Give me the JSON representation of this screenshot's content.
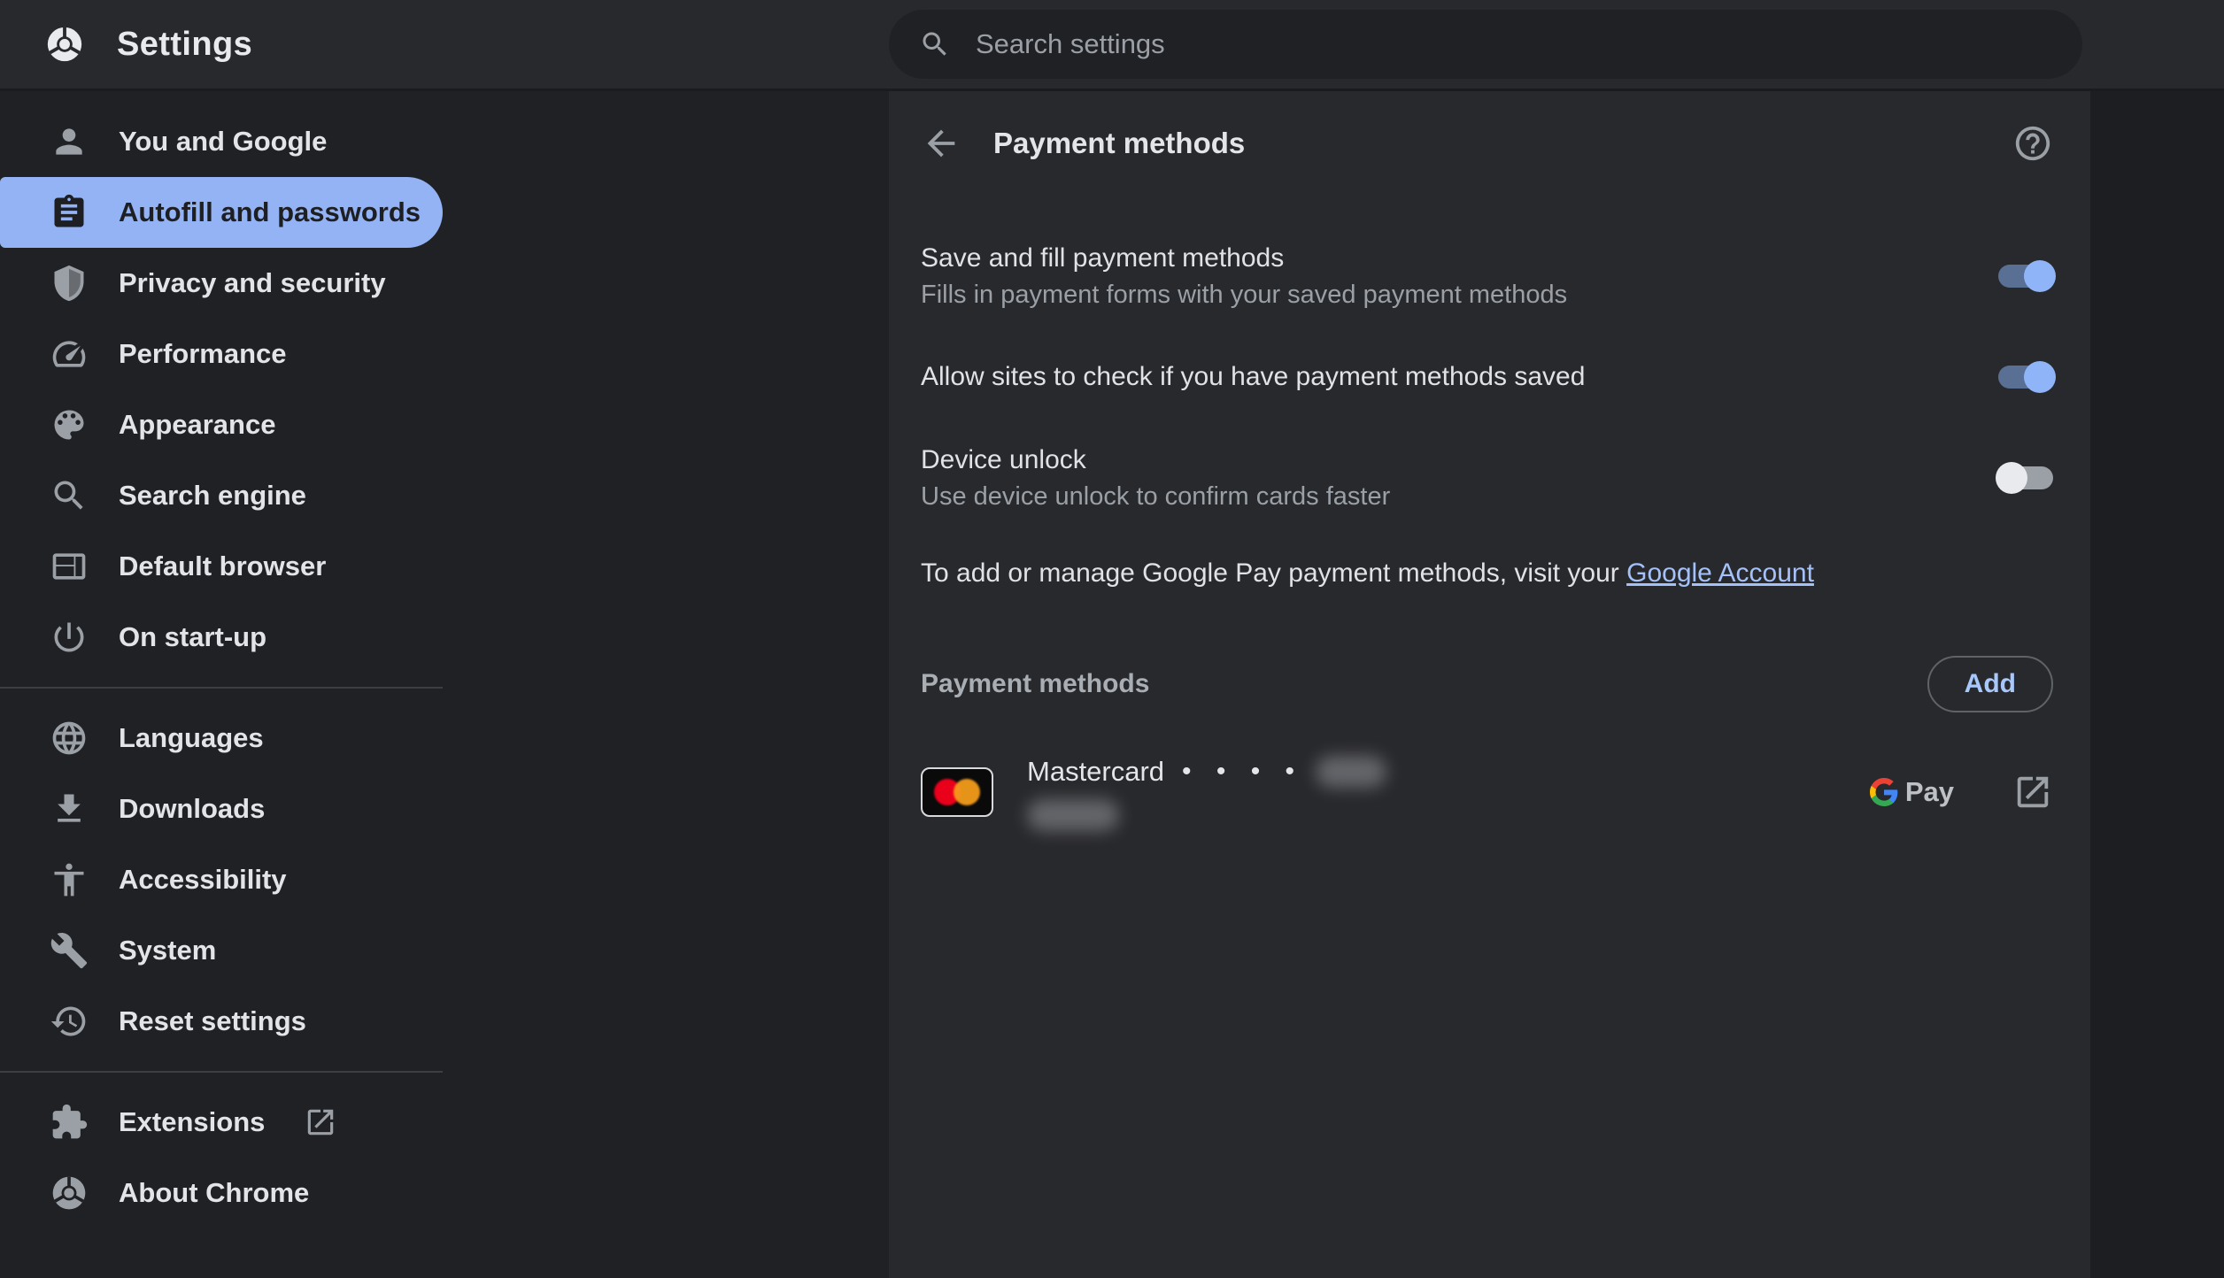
{
  "header": {
    "app_title": "Settings",
    "search_placeholder": "Search settings"
  },
  "sidebar": {
    "items": [
      {
        "label": "You and Google",
        "icon": "person-icon",
        "selected": "false"
      },
      {
        "label": "Autofill and passwords",
        "icon": "clipboard-icon",
        "selected": "true"
      },
      {
        "label": "Privacy and security",
        "icon": "shield-icon",
        "selected": "false"
      },
      {
        "label": "Performance",
        "icon": "speedometer-icon",
        "selected": "false"
      },
      {
        "label": "Appearance",
        "icon": "palette-icon",
        "selected": "false"
      },
      {
        "label": "Search engine",
        "icon": "magnifier-icon",
        "selected": "false"
      },
      {
        "label": "Default browser",
        "icon": "browser-window-icon",
        "selected": "false"
      },
      {
        "label": "On start-up",
        "icon": "power-icon",
        "selected": "false"
      },
      {
        "label": "Languages",
        "icon": "globe-icon",
        "selected": "false"
      },
      {
        "label": "Downloads",
        "icon": "download-icon",
        "selected": "false"
      },
      {
        "label": "Accessibility",
        "icon": "accessibility-icon",
        "selected": "false"
      },
      {
        "label": "System",
        "icon": "wrench-icon",
        "selected": "false"
      },
      {
        "label": "Reset settings",
        "icon": "history-icon",
        "selected": "false"
      },
      {
        "label": "Extensions",
        "icon": "puzzle-icon",
        "external": "true",
        "selected": "false"
      },
      {
        "label": "About Chrome",
        "icon": "chrome-icon",
        "selected": "false"
      }
    ]
  },
  "main": {
    "title": "Payment methods",
    "settings": [
      {
        "label": "Save and fill payment methods",
        "description": "Fills in payment forms with your saved payment methods",
        "enabled": "true"
      },
      {
        "label": "Allow sites to check if you have payment methods saved",
        "enabled": "true"
      },
      {
        "label": "Device unlock",
        "description": "Use device unlock to confirm cards faster",
        "enabled": "false"
      }
    ],
    "gpay_note": {
      "text": "To add or manage Google Pay payment methods, visit your",
      "link_label": "Google Account"
    },
    "section": {
      "title": "Payment methods",
      "add_button": "Add"
    },
    "cards": [
      {
        "network": "Mastercard",
        "dots": "• • • •",
        "digits_redacted": "true",
        "expiry_redacted": "true",
        "wallet_badge": "Pay"
      }
    ]
  },
  "colors": {
    "accent_blue": "#a8c7fa",
    "selected_pill": "#94b3f4",
    "toggle_on_thumb": "#8fb4f8",
    "card_bg": "#28292c",
    "page_bg": "#202124",
    "mastercard_red": "#eb001b",
    "mastercard_orange": "#f79e1b"
  }
}
